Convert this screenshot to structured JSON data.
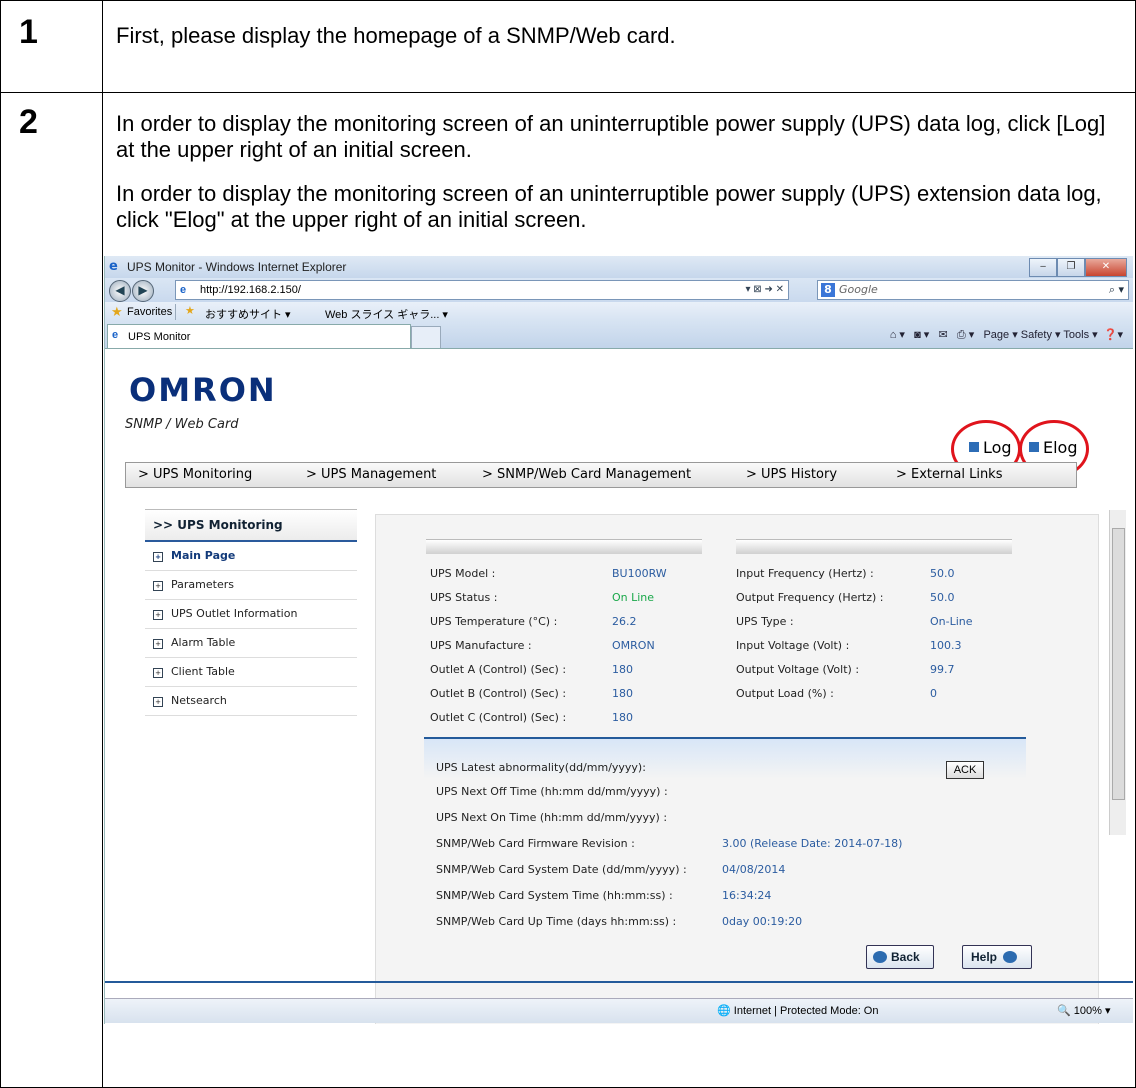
{
  "steps": [
    {
      "num": "1",
      "text": "First, please display the homepage of a SNMP/Web card."
    },
    {
      "num": "2",
      "p1": "In order to display the monitoring screen of an uninterruptible power supply (UPS) data log, click [Log] at the upper right of an initial screen.",
      "p2": "In order to display the monitoring screen of an uninterruptible power supply (UPS) extension data log, click \"Elog\" at the upper right of an initial screen."
    }
  ],
  "browser": {
    "title": "UPS Monitor - Windows Internet Explorer",
    "url": "http://192.168.2.150/",
    "search_placeholder": "Google",
    "favorites_label": "Favorites",
    "fav_item1": "おすすめサイト ▾",
    "fav_item2": "Web スライス ギャラ... ▾",
    "tab_label": "UPS Monitor",
    "cmd": "Page ▾   Safety ▾   Tools ▾",
    "status_zone": "Internet | Protected Mode: On",
    "zoom": "100%"
  },
  "page": {
    "logo": "OMRON",
    "subtitle": "SNMP / Web Card",
    "log_label": "Log",
    "elog_label": "Elog",
    "menu": [
      "> UPS Monitoring",
      "> UPS Management",
      "> SNMP/Web Card Management",
      "> UPS History",
      "> External Links"
    ],
    "nav_header": ">>  UPS Monitoring",
    "nav_items": [
      "Main Page",
      "Parameters",
      "UPS Outlet Information",
      "Alarm Table",
      "Client Table",
      "Netsearch"
    ],
    "left_rows": [
      {
        "label": "UPS Model :",
        "value": "BU100RW"
      },
      {
        "label": "UPS Status :",
        "value": "On Line"
      },
      {
        "label": "UPS Temperature (°C) :",
        "value": "26.2"
      },
      {
        "label": "UPS Manufacture :",
        "value": "OMRON"
      },
      {
        "label": "Outlet A (Control) (Sec) :",
        "value": "180"
      },
      {
        "label": "Outlet B (Control) (Sec) :",
        "value": "180"
      },
      {
        "label": "Outlet C (Control) (Sec) :",
        "value": "180"
      }
    ],
    "right_rows": [
      {
        "label": "Input Frequency (Hertz) :",
        "value": "50.0"
      },
      {
        "label": "Output Frequency (Hertz) :",
        "value": "50.0"
      },
      {
        "label": "UPS Type :",
        "value": "On-Line"
      },
      {
        "label": "Input Voltage (Volt) :",
        "value": "100.3"
      },
      {
        "label": "Output Voltage (Volt) :",
        "value": "99.7"
      },
      {
        "label": "Output Load (%) :",
        "value": "0"
      }
    ],
    "lower_rows": [
      {
        "label": "UPS Latest abnormality(dd/mm/yyyy):",
        "value": ""
      },
      {
        "label": "UPS Next Off Time (hh:mm dd/mm/yyyy) :",
        "value": ""
      },
      {
        "label": "UPS Next On Time (hh:mm dd/mm/yyyy) :",
        "value": ""
      },
      {
        "label": "SNMP/Web Card Firmware Revision :",
        "value": "3.00 (Release Date: 2014-07-18)"
      },
      {
        "label": "SNMP/Web Card System Date (dd/mm/yyyy) :",
        "value": "04/08/2014"
      },
      {
        "label": "SNMP/Web Card System Time (hh:mm:ss) :",
        "value": "16:34:24"
      },
      {
        "label": "SNMP/Web Card Up Time (days hh:mm:ss) :",
        "value": "0day 00:19:20"
      }
    ],
    "ack": "ACK",
    "back": "Back",
    "help": "Help"
  }
}
